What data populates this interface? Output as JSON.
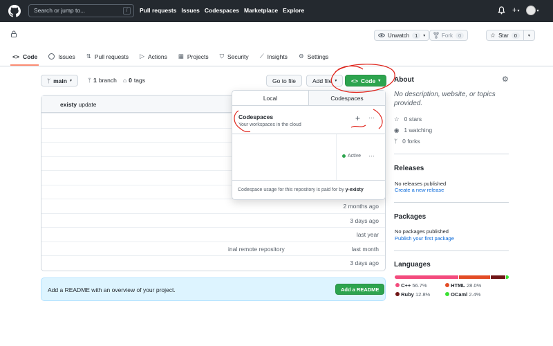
{
  "topbar": {
    "search_placeholder": "Search or jump to...",
    "search_shortcut": "/",
    "nav": [
      "Pull requests",
      "Issues",
      "Codespaces",
      "Marketplace",
      "Explore"
    ],
    "plus_label": "+"
  },
  "repo": {
    "watch_label": "Unwatch",
    "watch_count": "1",
    "fork_label": "Fork",
    "fork_count": "0",
    "star_label": "Star",
    "star_count": "0"
  },
  "tabs": [
    {
      "label": "Code",
      "icon": "code-icon"
    },
    {
      "label": "Issues",
      "icon": "issue-icon"
    },
    {
      "label": "Pull requests",
      "icon": "pull-request-icon"
    },
    {
      "label": "Actions",
      "icon": "play-icon"
    },
    {
      "label": "Projects",
      "icon": "table-icon"
    },
    {
      "label": "Security",
      "icon": "shield-icon"
    },
    {
      "label": "Insights",
      "icon": "graph-icon"
    },
    {
      "label": "Settings",
      "icon": "gear-icon"
    }
  ],
  "branch": {
    "name": "main",
    "branches_count": "1",
    "branches_label": "branch",
    "tags_count": "0",
    "tags_label": "tags",
    "goto_file": "Go to file",
    "add_file": "Add file",
    "code_button": "Code"
  },
  "commit": {
    "author": "existy",
    "message": "update"
  },
  "files": [
    {
      "name": "",
      "time": ""
    },
    {
      "name": "",
      "time": ""
    },
    {
      "name": "",
      "time": ""
    },
    {
      "name": "",
      "time": ""
    },
    {
      "name": "",
      "time": ""
    },
    {
      "name": "",
      "time": ""
    },
    {
      "name": "",
      "time": "2 months ago"
    },
    {
      "name": "",
      "time": "3 days ago"
    },
    {
      "name": "",
      "time": "last year"
    },
    {
      "name": "inal remote repository",
      "time": "last month"
    },
    {
      "name": "",
      "time": "3 days ago"
    }
  ],
  "dropdown": {
    "tab_local": "Local",
    "tab_codespaces": "Codespaces",
    "title": "Codespaces",
    "subtitle": "Your workspaces in the cloud",
    "plus": "+",
    "more": "···",
    "status": "Active",
    "footer_text": "Codespace usage for this repository is paid for by",
    "footer_user": "y-existy"
  },
  "readme": {
    "text": "Add a README with an overview of your project.",
    "button": "Add a README"
  },
  "about": {
    "title": "About",
    "description": "No description, website, or topics provided.",
    "stars": "0 stars",
    "watching": "1 watching",
    "forks": "0 forks"
  },
  "releases": {
    "title": "Releases",
    "none": "No releases published",
    "link": "Create a new release"
  },
  "packages": {
    "title": "Packages",
    "none": "No packages published",
    "link": "Publish your first package"
  },
  "languages": {
    "title": "Languages",
    "items": [
      {
        "name": "C++",
        "pct": "56.7%",
        "value": 56.7,
        "color": "#f34b7d"
      },
      {
        "name": "HTML",
        "pct": "28.0%",
        "value": 28.0,
        "color": "#e34c26"
      },
      {
        "name": "Ruby",
        "pct": "12.8%",
        "value": 12.8,
        "color": "#701516"
      },
      {
        "name": "OCaml",
        "pct": "2.4%",
        "value": 2.4,
        "color": "#3be133"
      }
    ]
  }
}
